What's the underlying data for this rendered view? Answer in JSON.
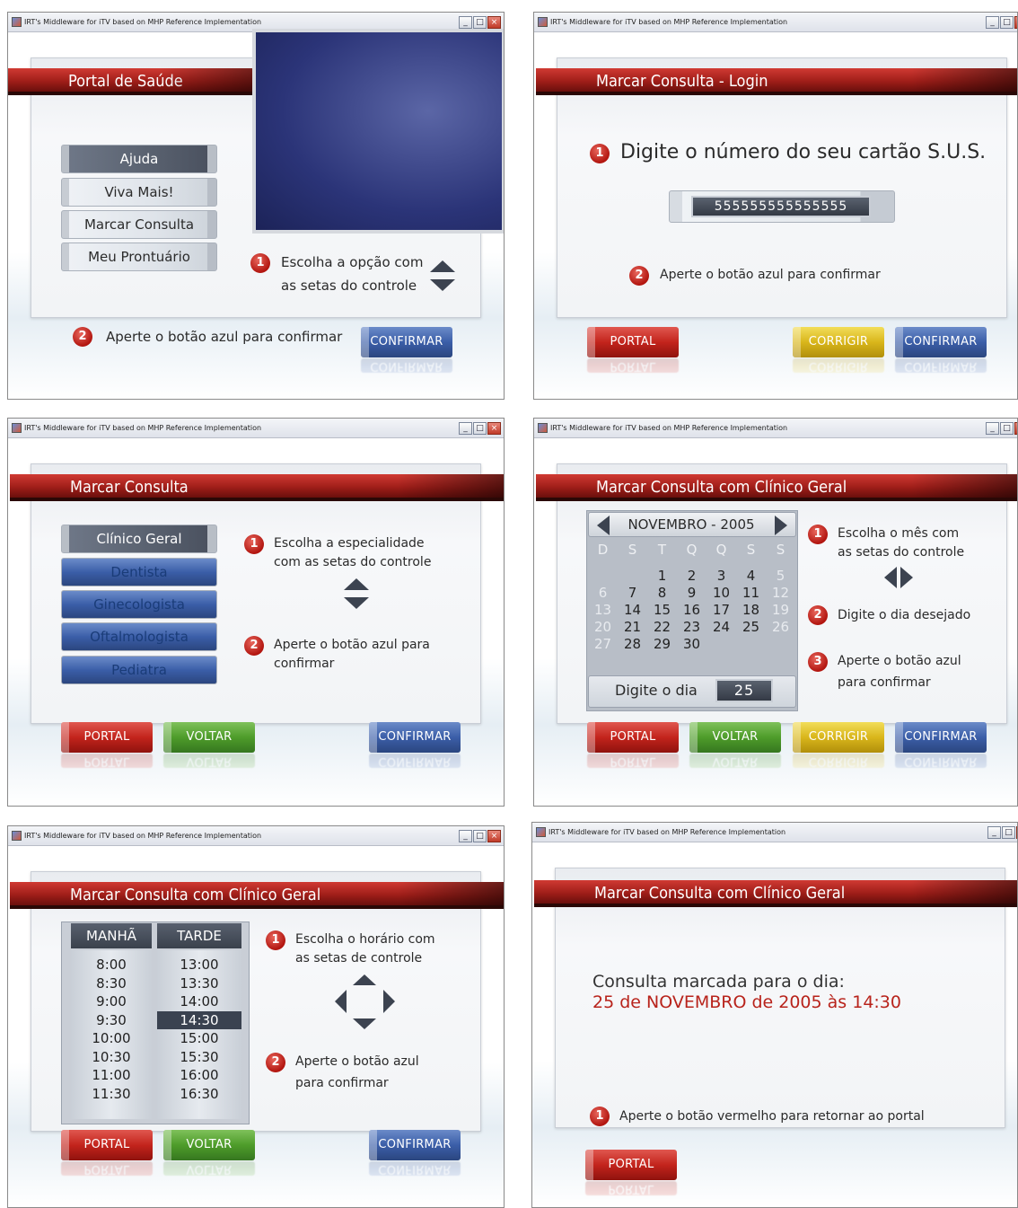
{
  "titlebar": "IRT's Middleware for iTV based on MHP Reference Implementation",
  "window_buttons": {
    "min": "_",
    "max": "□",
    "close": "×"
  },
  "screen1": {
    "header": "Portal de Saúde",
    "menu": [
      "Ajuda",
      "Viva Mais!",
      "Marcar Consulta",
      "Meu Prontuário"
    ],
    "step1_num": "1",
    "step1_line1": "Escolha a opção com",
    "step1_line2": "as setas do controle",
    "step2_num": "2",
    "step2": "Aperte o botão azul para confirmar",
    "confirm": "CONFIRMAR"
  },
  "screen2": {
    "header": "Marcar Consulta - Login",
    "step1_num": "1",
    "step1": "Digite o número do seu cartão S.U.S.",
    "card_value": "555555555555555",
    "step2_num": "2",
    "step2": "Aperte o botão azul para confirmar",
    "buttons": {
      "portal": "PORTAL",
      "corrigir": "CORRIGIR",
      "confirmar": "CONFIRMAR"
    }
  },
  "screen3": {
    "header": "Marcar Consulta",
    "menu": [
      "Clínico Geral",
      "Dentista",
      "Ginecologista",
      "Oftalmologista",
      "Pediatra"
    ],
    "step1_num": "1",
    "step1_line1": "Escolha a especialidade",
    "step1_line2": "com as setas do controle",
    "step2_num": "2",
    "step2_line1": "Aperte o botão azul para",
    "step2_line2": "confirmar",
    "buttons": {
      "portal": "PORTAL",
      "voltar": "VOLTAR",
      "confirmar": "CONFIRMAR"
    }
  },
  "screen4": {
    "header": "Marcar Consulta com Clínico Geral",
    "month": "NOVEMBRO - 2005",
    "weekdays": [
      "D",
      "S",
      "T",
      "Q",
      "Q",
      "S",
      "S"
    ],
    "weeks": [
      [
        "",
        "",
        "1",
        "2",
        "3",
        "4",
        "5"
      ],
      [
        "6",
        "7",
        "8",
        "9",
        "10",
        "11",
        "12"
      ],
      [
        "13",
        "14",
        "15",
        "16",
        "17",
        "18",
        "19"
      ],
      [
        "20",
        "21",
        "22",
        "23",
        "24",
        "25",
        "26"
      ],
      [
        "27",
        "28",
        "29",
        "30",
        "",
        "",
        ""
      ]
    ],
    "day_label": "Digite o dia",
    "day_value": "25",
    "step1_num": "1",
    "step1_line1": "Escolha o mês com",
    "step1_line2": "as setas do controle",
    "step2_num": "2",
    "step2": "Digite o dia desejado",
    "step3_num": "3",
    "step3_line1": "Aperte o botão azul",
    "step3_line2": "para confirmar",
    "buttons": {
      "portal": "PORTAL",
      "voltar": "VOLTAR",
      "corrigir": "CORRIGIR",
      "confirmar": "CONFIRMAR"
    }
  },
  "screen5": {
    "header": "Marcar Consulta com Clínico Geral",
    "col_manha": "MANHÃ",
    "col_tarde": "TARDE",
    "manha": [
      "8:00",
      "8:30",
      "9:00",
      "9:30",
      "10:00",
      "10:30",
      "11:00",
      "11:30"
    ],
    "tarde": [
      "13:00",
      "13:30",
      "14:00",
      "14:30",
      "15:00",
      "15:30",
      "16:00",
      "16:30"
    ],
    "selected_time": "14:30",
    "step1_num": "1",
    "step1_line1": "Escolha o horário com",
    "step1_line2": "as setas de controle",
    "step2_num": "2",
    "step2_line1": "Aperte o botão azul",
    "step2_line2": "para confirmar",
    "buttons": {
      "portal": "PORTAL",
      "voltar": "VOLTAR",
      "confirmar": "CONFIRMAR"
    }
  },
  "screen6": {
    "header": "Marcar Consulta com Clínico Geral",
    "line1": "Consulta marcada para o dia:",
    "line2": "25 de NOVEMBRO de 2005 às 14:30",
    "step1_num": "1",
    "step1": "Aperte o botão vermelho para retornar ao portal",
    "portal": "PORTAL"
  },
  "colors": {
    "header_red": "#b8231b",
    "confirm_blue": "#3b5ea8",
    "back_green": "#4e9c2a",
    "fix_yellow": "#d9b61b"
  }
}
